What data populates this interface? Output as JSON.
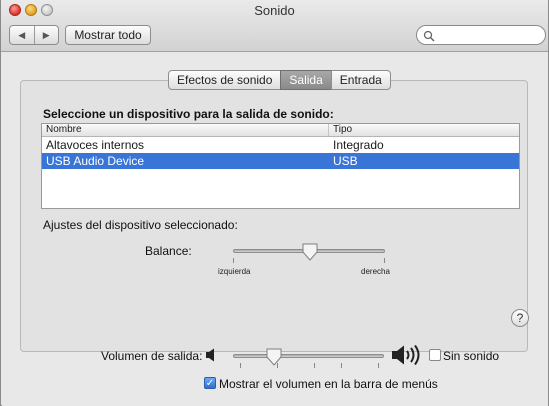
{
  "window": {
    "title": "Sonido"
  },
  "toolbar": {
    "back_glyph": "◀",
    "forward_glyph": "▶",
    "show_all_label": "Mostrar todo",
    "search_placeholder": ""
  },
  "tabs": [
    {
      "label": "Efectos de sonido",
      "active": false
    },
    {
      "label": "Salida",
      "active": true
    },
    {
      "label": "Entrada",
      "active": false
    }
  ],
  "output": {
    "select_heading": "Seleccione un dispositivo para la salida de sonido:",
    "columns": [
      "Nombre",
      "Tipo"
    ],
    "devices": [
      {
        "name": "Altavoces internos",
        "type": "Integrado",
        "selected": false
      },
      {
        "name": "USB Audio Device",
        "type": "USB",
        "selected": true
      }
    ],
    "settings_heading": "Ajustes del dispositivo seleccionado:",
    "balance_label": "Balance:",
    "balance_left": "izquierda",
    "balance_right": "derecha",
    "balance_value": 0.5
  },
  "help_glyph": "?",
  "volume": {
    "label": "Volumen de salida:",
    "level": 0.27,
    "mute_label": "Sin sonido",
    "mute_checked": false,
    "show_in_menubar_label": "Mostrar el volumen en la barra de menús",
    "show_in_menubar_checked": true
  },
  "colors": {
    "selection": "#3875d7",
    "active_tab": "#8a8a8a"
  },
  "icons": {
    "close": "close-traffic-light",
    "minimize": "minimize-traffic-light",
    "zoom": "zoom-traffic-light",
    "search": "search-icon",
    "speaker_low": "speaker-low-icon",
    "speaker_high": "speaker-high-icon"
  }
}
